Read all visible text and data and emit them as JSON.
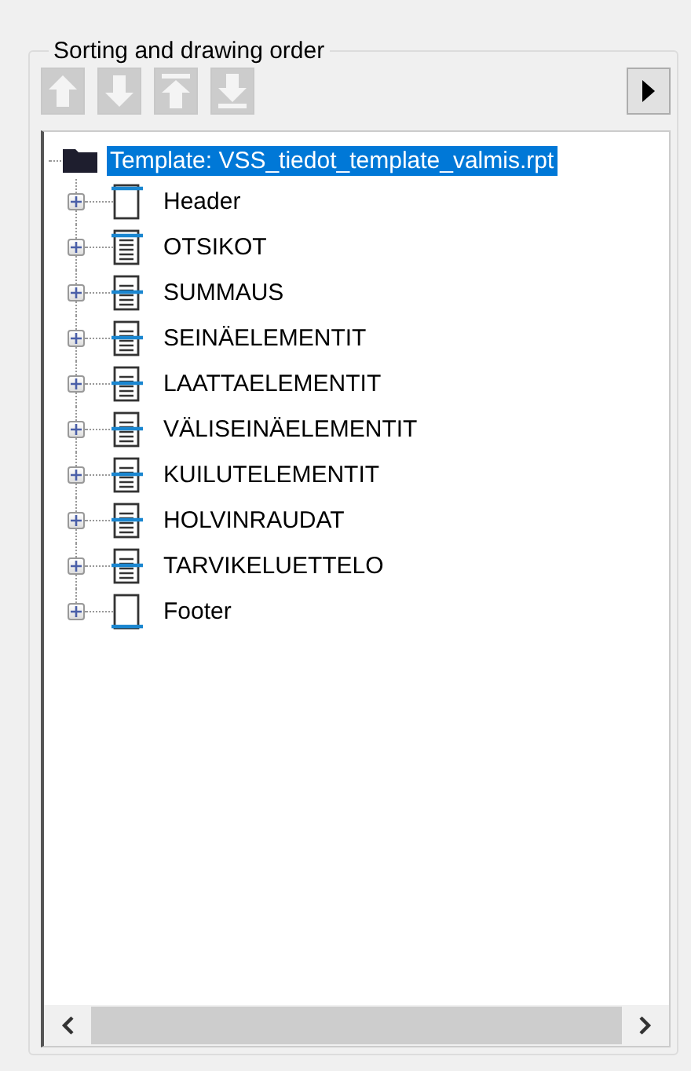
{
  "group": {
    "title": "Sorting and drawing order"
  },
  "toolbar": {
    "buttons": [
      {
        "kind": "up",
        "disabled": true
      },
      {
        "kind": "down",
        "disabled": true
      },
      {
        "kind": "top",
        "disabled": true
      },
      {
        "kind": "bottom",
        "disabled": true
      }
    ],
    "run_button": {
      "disabled": false
    }
  },
  "tree": {
    "root": {
      "label": "Template: VSS_tiedot_template_valmis.rpt",
      "selected": true,
      "expanded": true,
      "children": [
        {
          "label": "Header",
          "kind": "header",
          "expanded": false,
          "selected": false
        },
        {
          "label": "OTSIKOT",
          "kind": "heading",
          "expanded": false,
          "selected": false
        },
        {
          "label": "SUMMAUS",
          "kind": "group",
          "expanded": false,
          "selected": false
        },
        {
          "label": "SEINÄELEMENTIT",
          "kind": "group",
          "expanded": false,
          "selected": false
        },
        {
          "label": "LAATTAELEMENTIT",
          "kind": "group",
          "expanded": false,
          "selected": false
        },
        {
          "label": "VÄLISEINÄELEMENTIT",
          "kind": "group",
          "expanded": false,
          "selected": false
        },
        {
          "label": "KUILUTELEMENTIT",
          "kind": "group",
          "expanded": false,
          "selected": false
        },
        {
          "label": "HOLVINRAUDAT",
          "kind": "group",
          "expanded": false,
          "selected": false
        },
        {
          "label": "TARVIKELUETTELO",
          "kind": "group",
          "expanded": false,
          "selected": false
        },
        {
          "label": "Footer",
          "kind": "footer",
          "expanded": false,
          "selected": false
        }
      ]
    }
  }
}
